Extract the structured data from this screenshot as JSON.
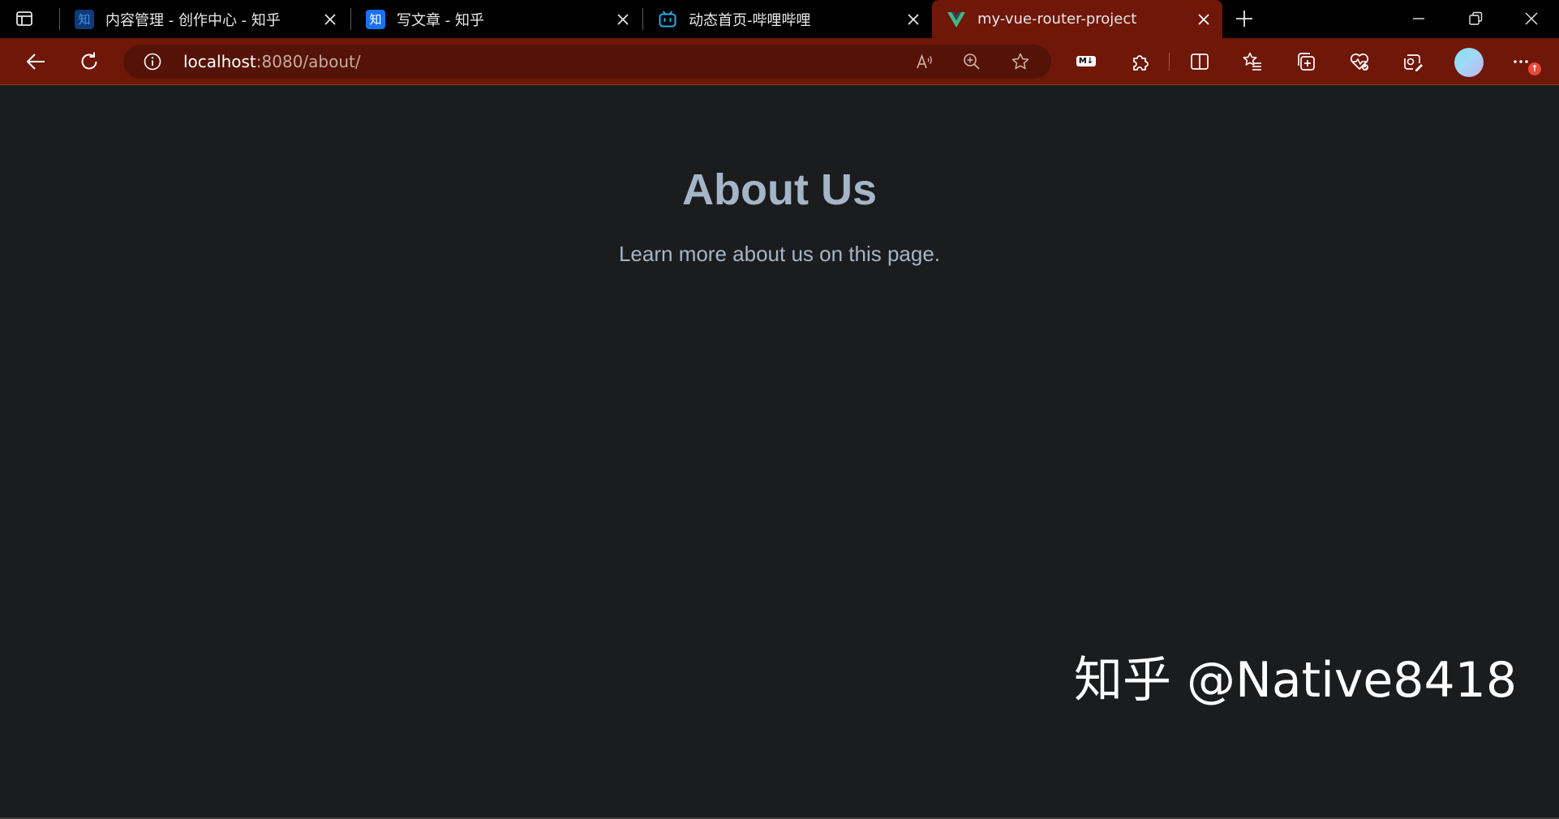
{
  "browser": {
    "tabs": [
      {
        "title": "内容管理 - 创作中心 - 知乎",
        "favicon": "zhihu-icon",
        "favicon_char": "知",
        "active": false
      },
      {
        "title": "写文章 - 知乎",
        "favicon": "zhihu-icon",
        "favicon_char": "知",
        "active": false
      },
      {
        "title": "动态首页-哔哩哔哩",
        "favicon": "bilibili-icon",
        "active": false
      },
      {
        "title": "my-vue-router-project",
        "favicon": "vue-icon",
        "active": true
      }
    ],
    "address_bar": {
      "host": "localhost",
      "rest": ":8080/about/"
    },
    "toolbar_extras": {
      "markdown_icon_label": "M↓",
      "notification_badge": "↑"
    },
    "colors": {
      "frame": "#6f1709",
      "omnibox": "#541306",
      "tabstrip": "#000000"
    }
  },
  "page": {
    "heading": "About Us",
    "text": "Learn more about us on this page.",
    "background": "#1b1c1e",
    "text_color": "#a5b5c8"
  },
  "watermark": {
    "text": "知乎 @Native8418"
  }
}
